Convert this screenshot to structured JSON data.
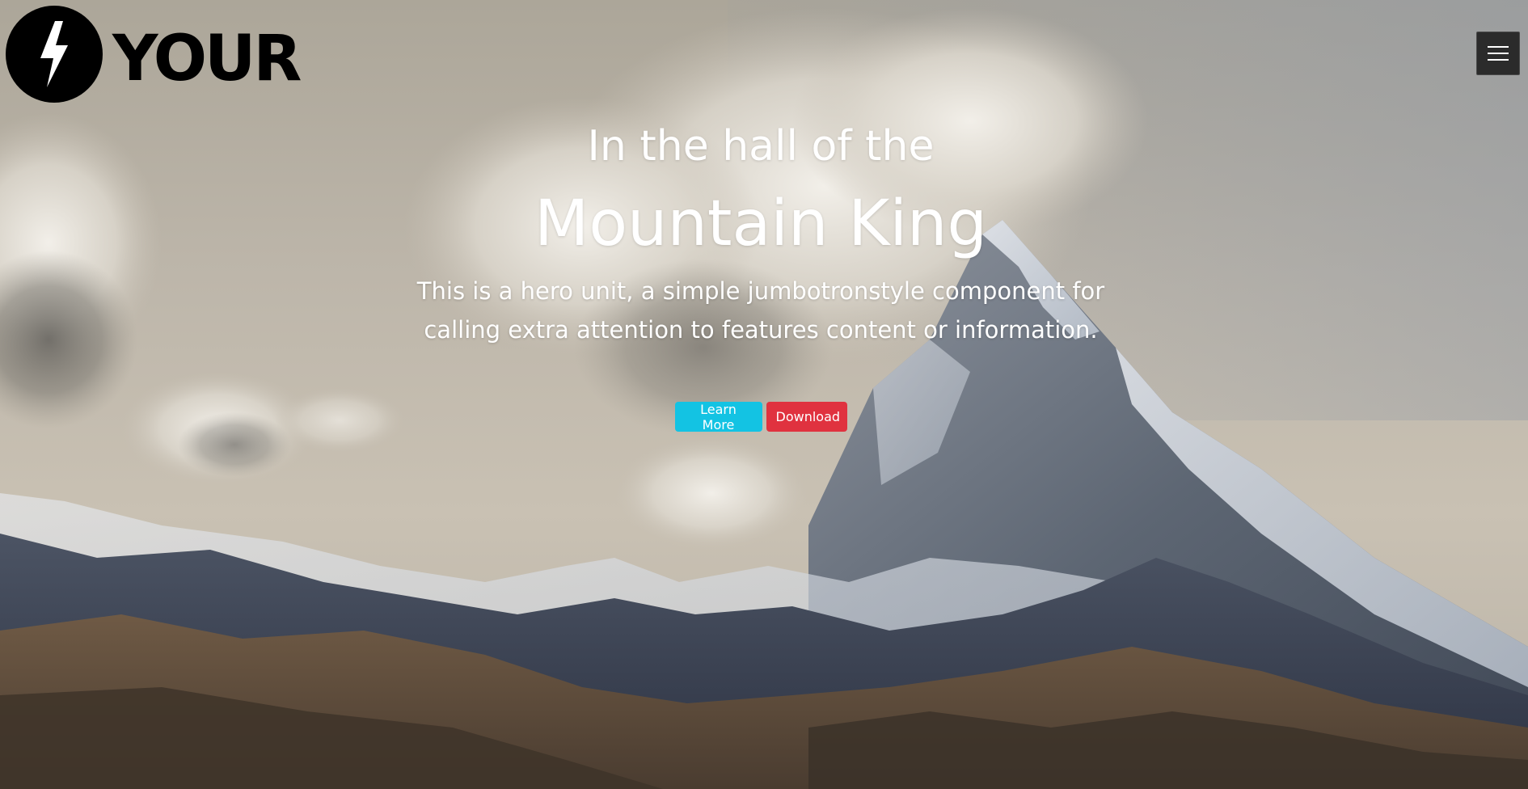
{
  "brand": {
    "logo_text": "YOUR",
    "logo_icon": "lightning-bolt-icon"
  },
  "nav": {
    "menu_icon": "hamburger-menu-icon"
  },
  "hero": {
    "eyebrow": "In the hall of the",
    "title": "Mountain King",
    "lead": "This is a hero unit, a simple jumbotronstyle component for calling extra attention to features content or information.",
    "primary_button": "Learn More",
    "secondary_button": "Download",
    "background_image": "snowy-mountain-peak-with-clouds"
  },
  "colors": {
    "info": "#13c3e3",
    "danger": "#e0323f",
    "logo": "#000000",
    "menu_button": "#2b2b2b"
  }
}
